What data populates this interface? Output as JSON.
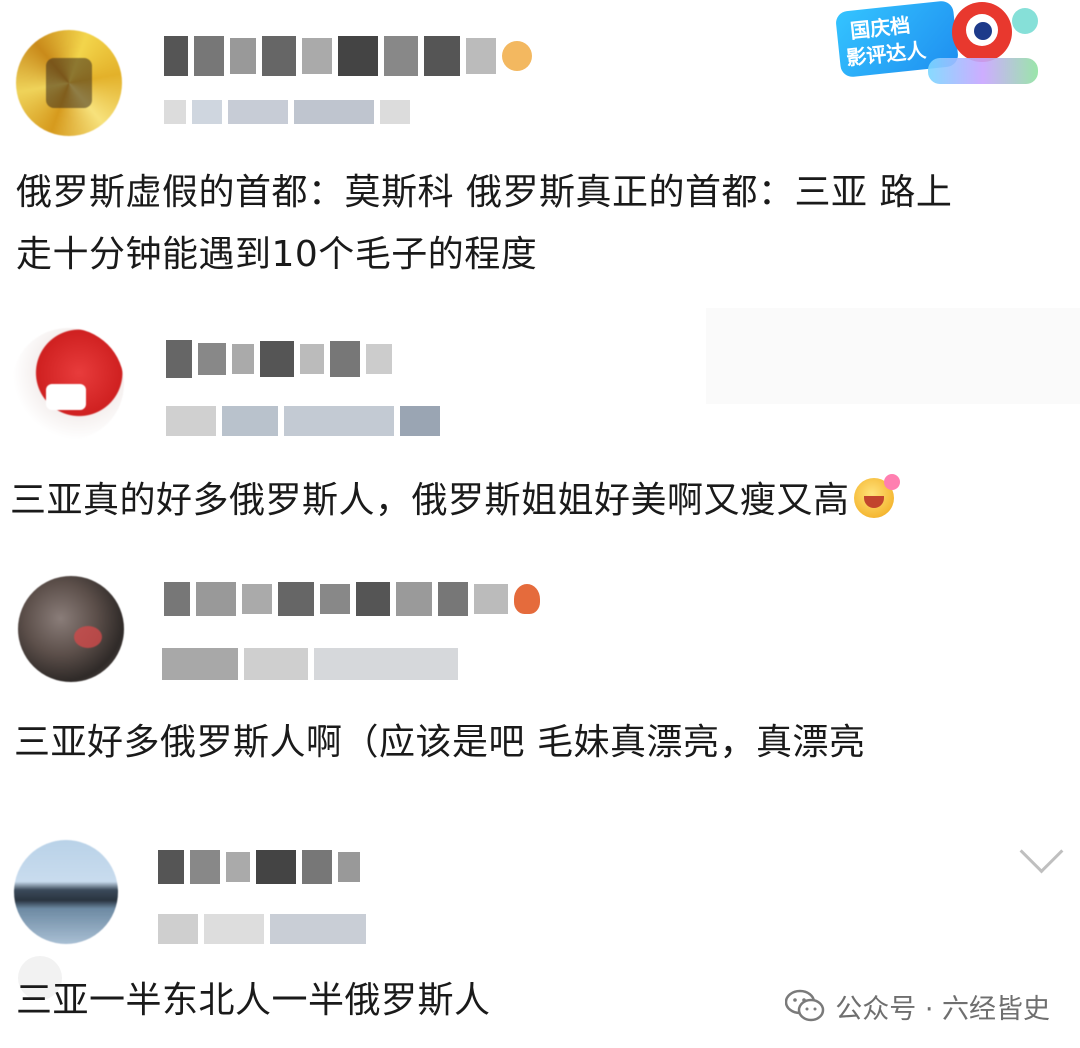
{
  "comments": [
    {
      "text": "俄罗斯虚假的首都：莫斯科 俄罗斯真正的首都：三亚 路上",
      "text2": "走十分钟能遇到10个毛子的程度",
      "badge": "国庆档\n影评达人"
    },
    {
      "text": "三亚真的好多俄罗斯人，俄罗斯姐姐好美啊又瘦又高"
    },
    {
      "text": "三亚好多俄罗斯人啊（应该是吧 毛妹真漂亮，真漂亮"
    },
    {
      "text": "三亚一半东北人一半俄罗斯人"
    }
  ],
  "badge": {
    "line1": "国庆档",
    "line2": "影评达人"
  },
  "watermark": {
    "label": "公众号 · 六经皆史"
  },
  "icons": {
    "comment1_name_emoji": "heart-icon",
    "comment3_name_emoji": "lotus-icon",
    "comment2_emoji": "laugh-emoji-icon",
    "expand": "chevron-down-icon",
    "watermark": "wechat-icon"
  }
}
